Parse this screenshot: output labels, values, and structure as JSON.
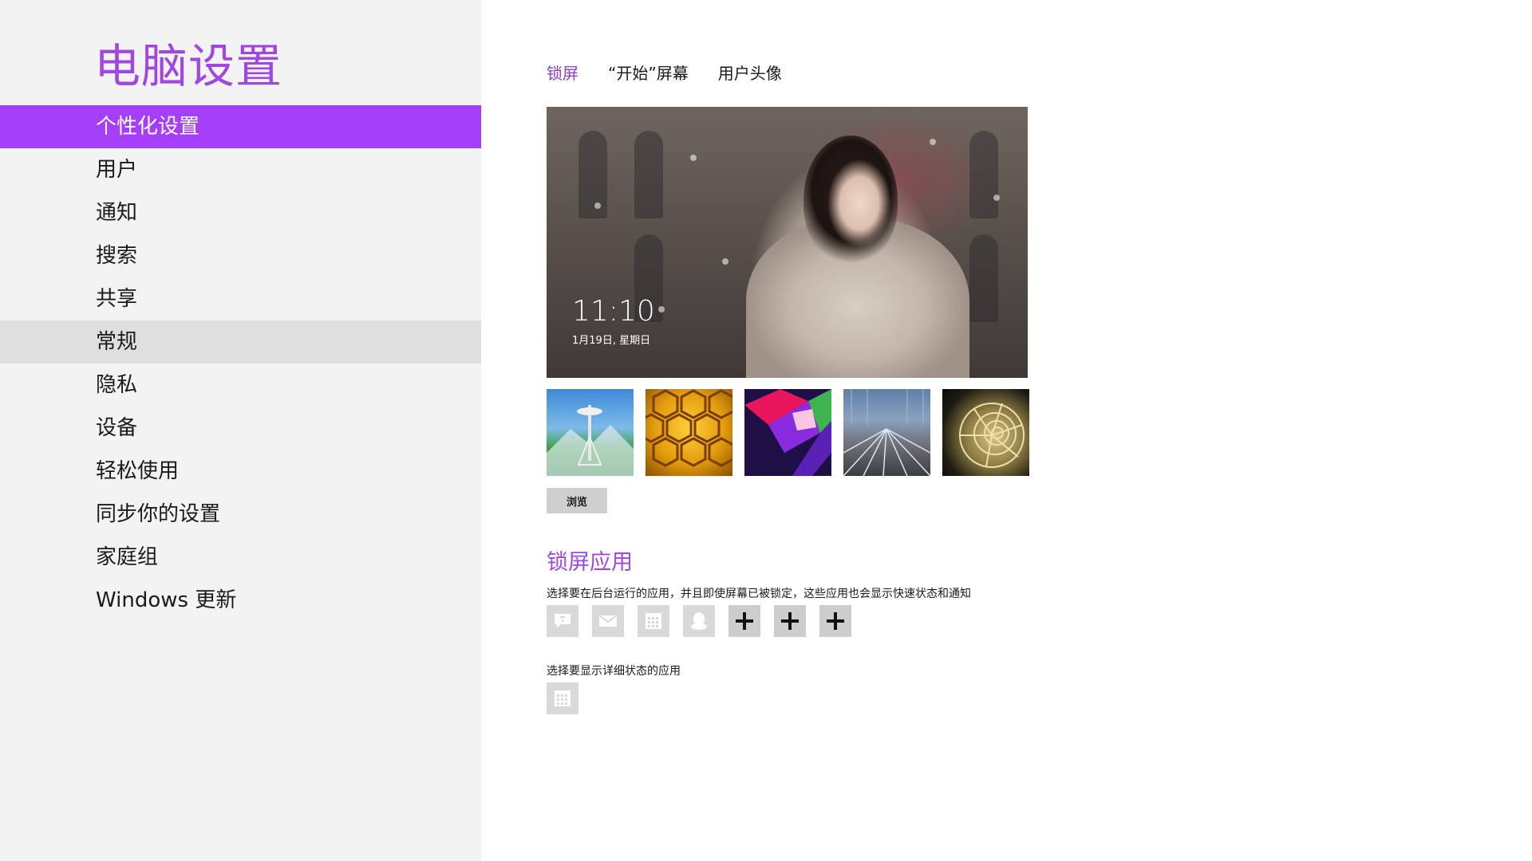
{
  "app": {
    "title": "电脑设置"
  },
  "nav": {
    "items": [
      {
        "label": "个性化设置",
        "state": "selected"
      },
      {
        "label": "用户"
      },
      {
        "label": "通知"
      },
      {
        "label": "搜索"
      },
      {
        "label": "共享"
      },
      {
        "label": "常规",
        "state": "hover"
      },
      {
        "label": "隐私"
      },
      {
        "label": "设备"
      },
      {
        "label": "轻松使用"
      },
      {
        "label": "同步你的设置"
      },
      {
        "label": "家庭组"
      },
      {
        "label": "Windows 更新"
      }
    ]
  },
  "tabs": [
    {
      "label": "锁屏",
      "active": true
    },
    {
      "label": "“开始”屏幕"
    },
    {
      "label": "用户头像"
    }
  ],
  "lock_screen": {
    "time": "11:10",
    "date": "1月19日, 星期日"
  },
  "backgrounds": [
    {
      "name": "space-needle-thumbnail"
    },
    {
      "name": "honeycomb-thumbnail"
    },
    {
      "name": "geometric-thumbnail"
    },
    {
      "name": "rail-tracks-thumbnail"
    },
    {
      "name": "nautilus-shell-thumbnail"
    }
  ],
  "browse_label": "浏览",
  "lock_apps": {
    "title": "锁屏应用",
    "description": "选择要在后台运行的应用，并且即使屏幕已被锁定，这些应用也会显示快速状态和通知",
    "slots": [
      {
        "icon": "messaging-icon"
      },
      {
        "icon": "mail-icon"
      },
      {
        "icon": "calendar-icon"
      },
      {
        "icon": "qq-icon"
      },
      {
        "icon": "add-icon"
      },
      {
        "icon": "add-icon"
      },
      {
        "icon": "add-icon"
      }
    ],
    "detail_description": "选择要显示详细状态的应用",
    "detail_slot": {
      "icon": "calendar-icon"
    }
  },
  "colors": {
    "accent": "#a43ef9",
    "title": "#9f47e0",
    "left_pane_bg": "#f3f3f3",
    "hover_bg": "#dedede"
  }
}
